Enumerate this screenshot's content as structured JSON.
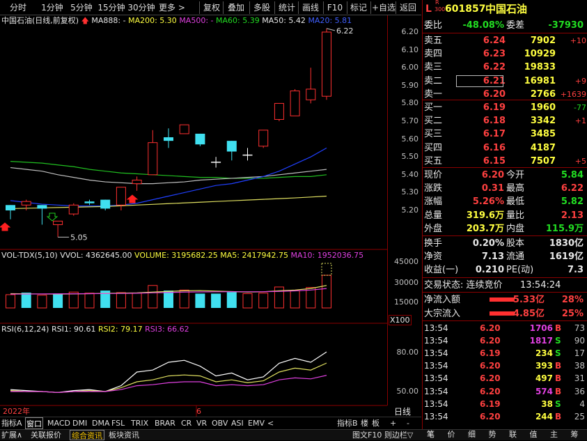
{
  "toolbar": {
    "left": [
      "分时",
      "1分钟",
      "5分钟",
      "15分钟",
      "30分钟",
      "更多 >"
    ],
    "right": [
      "复权",
      "叠加",
      "多股",
      "统计",
      "画线",
      "F10",
      "标记",
      "+自选",
      "返回"
    ]
  },
  "kline": {
    "title": "中国石油(日线,前复权)",
    "ma888": "MA888: -",
    "ma200": "MA200: 5.30",
    "ma500": "MA500: -",
    "ma60": "MA60: 5.39",
    "ma50": "MA50: 5.42",
    "ma20": "MA20: 5.81",
    "high_label": "6.22",
    "low_label": "5.05",
    "yticks": [
      "6.20",
      "6.10",
      "6.00",
      "5.90",
      "5.80",
      "5.70",
      "5.60",
      "5.50",
      "5.40",
      "5.30",
      "5.20"
    ]
  },
  "vol": {
    "title": "VOL-TDX(5,10)",
    "vvol": "VVOL: 4362645.00",
    "volume": "VOLUME: 3195682.25",
    "ma5": "MA5: 2417942.75",
    "ma10": "MA10: 1952036.75",
    "yticks": [
      "45000",
      "30000",
      "15000"
    ],
    "unit": "X100"
  },
  "rsi": {
    "title": "RSI(6,12,24)",
    "rsi1": "RSI1: 90.61",
    "rsi2": "RSI2: 79.17",
    "rsi3": "RSI3: 66.62",
    "yticks": [
      "80.00",
      "50.00"
    ]
  },
  "dates": {
    "year": "2022年",
    "mark": "6",
    "period": "日线"
  },
  "indicator_tabs": [
    "指标A",
    "窗口",
    "MACD",
    "DMI",
    "DMA",
    "FSL",
    "TRIX",
    "BRAR",
    "CR",
    "VR",
    "OBV",
    "ASI",
    "EMV",
    "<"
  ],
  "indicator_right": [
    "指标B",
    "楼",
    "板",
    "+",
    "-"
  ],
  "bottom_tabs": [
    "扩展∧",
    "关联报价",
    "综合资讯",
    "板块资讯"
  ],
  "bottom_right": "图文F10 则边栏▽",
  "quote": {
    "code": "601857",
    "name": "中国石油",
    "flag_L": "L",
    "flag_R": "R",
    "flag_300": "300",
    "weibi_label": "委比",
    "weibi": "-48.08%",
    "weicha_label": "委差",
    "weicha": "-37930",
    "sell": [
      {
        "label": "卖五",
        "price": "6.24",
        "vol": "7902",
        "chg": "+10"
      },
      {
        "label": "卖四",
        "price": "6.23",
        "vol": "10929",
        "chg": ""
      },
      {
        "label": "卖三",
        "price": "6.22",
        "vol": "19833",
        "chg": ""
      },
      {
        "label": "卖二",
        "price": "6.21",
        "vol": "16981",
        "chg": "+9"
      },
      {
        "label": "卖一",
        "price": "6.20",
        "vol": "2766",
        "chg": "+1639"
      }
    ],
    "buy": [
      {
        "label": "买一",
        "price": "6.19",
        "vol": "1960",
        "chg": "-77"
      },
      {
        "label": "买二",
        "price": "6.18",
        "vol": "3342",
        "chg": "+1"
      },
      {
        "label": "买三",
        "price": "6.17",
        "vol": "3485",
        "chg": ""
      },
      {
        "label": "买四",
        "price": "6.16",
        "vol": "4187",
        "chg": ""
      },
      {
        "label": "买五",
        "price": "6.15",
        "vol": "7507",
        "chg": "+5"
      }
    ],
    "stats": [
      {
        "l1": "现价",
        "v1": "6.20",
        "l2": "今开",
        "v2": "5.84"
      },
      {
        "l1": "涨跌",
        "v1": "0.31",
        "l2": "最高",
        "v2": "6.22"
      },
      {
        "l1": "涨幅",
        "v1": "5.26%",
        "l2": "最低",
        "v2": "5.82"
      },
      {
        "l1": "总量",
        "v1": "319.6万",
        "l2": "量比",
        "v2": "2.13"
      },
      {
        "l1": "外盘",
        "v1": "203.7万",
        "l2": "内盘",
        "v2": "115.9万"
      }
    ],
    "stats2": [
      {
        "l1": "换手",
        "v1": "0.20%",
        "l2": "股本",
        "v2": "1830亿"
      },
      {
        "l1": "净资",
        "v1": "7.13",
        "l2": "流通",
        "v2": "1619亿"
      },
      {
        "l1": "收益(一)",
        "v1": "0.210",
        "l2": "PE(动)",
        "v2": "7.3"
      }
    ],
    "trade_state": "交易状态: 连续竞价",
    "trade_time": "13:54:24",
    "flow": [
      {
        "label": "净流入额",
        "value": "5.33亿",
        "pct": "28%"
      },
      {
        "label": "大宗流入",
        "value": "4.85亿",
        "pct": "25%"
      }
    ],
    "ticks": [
      {
        "t": "13:54",
        "p": "6.20",
        "v": "1706",
        "d": "B",
        "n": "73"
      },
      {
        "t": "13:54",
        "p": "6.20",
        "v": "1817",
        "d": "S",
        "n": "90"
      },
      {
        "t": "13:54",
        "p": "6.19",
        "v": "234",
        "d": "S",
        "n": "17"
      },
      {
        "t": "13:54",
        "p": "6.20",
        "v": "393",
        "d": "B",
        "n": "38"
      },
      {
        "t": "13:54",
        "p": "6.20",
        "v": "497",
        "d": "B",
        "n": "31"
      },
      {
        "t": "13:54",
        "p": "6.20",
        "v": "574",
        "d": "B",
        "n": "36"
      },
      {
        "t": "13:54",
        "p": "6.19",
        "v": "38",
        "d": "S",
        "n": "4"
      },
      {
        "t": "13:54",
        "p": "6.20",
        "v": "244",
        "d": "B",
        "n": "25"
      }
    ],
    "panel_tabs": [
      "笔",
      "价",
      "细",
      "势",
      "联",
      "值",
      "主",
      "筹"
    ]
  },
  "candles": [
    {
      "o": 5.23,
      "c": 5.2,
      "h": 5.23,
      "l": 5.15
    },
    {
      "o": 5.23,
      "c": 5.25,
      "h": 5.26,
      "l": 5.2
    },
    {
      "o": 5.23,
      "c": 5.21,
      "h": 5.23,
      "l": 5.12
    },
    {
      "o": 5.12,
      "c": 5.14,
      "h": 5.14,
      "l": 5.05
    },
    {
      "o": 5.18,
      "c": 5.23,
      "h": 5.24,
      "l": 5.17
    },
    {
      "o": 5.25,
      "c": 5.24,
      "h": 5.26,
      "l": 5.23
    },
    {
      "o": 5.26,
      "c": 5.21,
      "h": 5.26,
      "l": 5.2
    },
    {
      "o": 5.23,
      "c": 5.33,
      "h": 5.33,
      "l": 5.2
    },
    {
      "o": 5.35,
      "c": 5.37,
      "h": 5.39,
      "l": 5.31
    },
    {
      "o": 5.4,
      "c": 5.58,
      "h": 5.65,
      "l": 5.4
    },
    {
      "o": 5.61,
      "c": 5.59,
      "h": 5.66,
      "l": 5.55
    },
    {
      "o": 5.63,
      "c": 5.68,
      "h": 5.68,
      "l": 5.64
    },
    {
      "o": 5.63,
      "c": 5.57,
      "h": 5.63,
      "l": 5.56
    },
    {
      "o": 5.47,
      "c": 5.47,
      "h": 5.5,
      "l": 5.44
    },
    {
      "o": 5.59,
      "c": 5.53,
      "h": 5.59,
      "l": 5.48
    },
    {
      "o": 5.51,
      "c": 5.51,
      "h": 5.55,
      "l": 5.48
    },
    {
      "o": 5.56,
      "c": 5.65,
      "h": 5.65,
      "l": 5.55
    },
    {
      "o": 5.71,
      "c": 5.8,
      "h": 5.8,
      "l": 5.7
    },
    {
      "o": 5.73,
      "c": 5.87,
      "h": 5.88,
      "l": 5.73
    },
    {
      "o": 5.82,
      "c": 5.88,
      "h": 6.0,
      "l": 5.8
    },
    {
      "o": 5.84,
      "c": 6.2,
      "h": 6.22,
      "l": 5.82
    }
  ],
  "volumes": [
    13000,
    15000,
    12500,
    14000,
    15500,
    14500,
    17000,
    15000,
    14500,
    22000,
    17000,
    17500,
    14000,
    14000,
    15500,
    14000,
    14500,
    20500,
    17000,
    20000,
    32000
  ],
  "vol_up": [
    true,
    false,
    true,
    false,
    true,
    true,
    false,
    true,
    true,
    true,
    false,
    true,
    false,
    false,
    false,
    true,
    true,
    true,
    true,
    true,
    true
  ]
}
